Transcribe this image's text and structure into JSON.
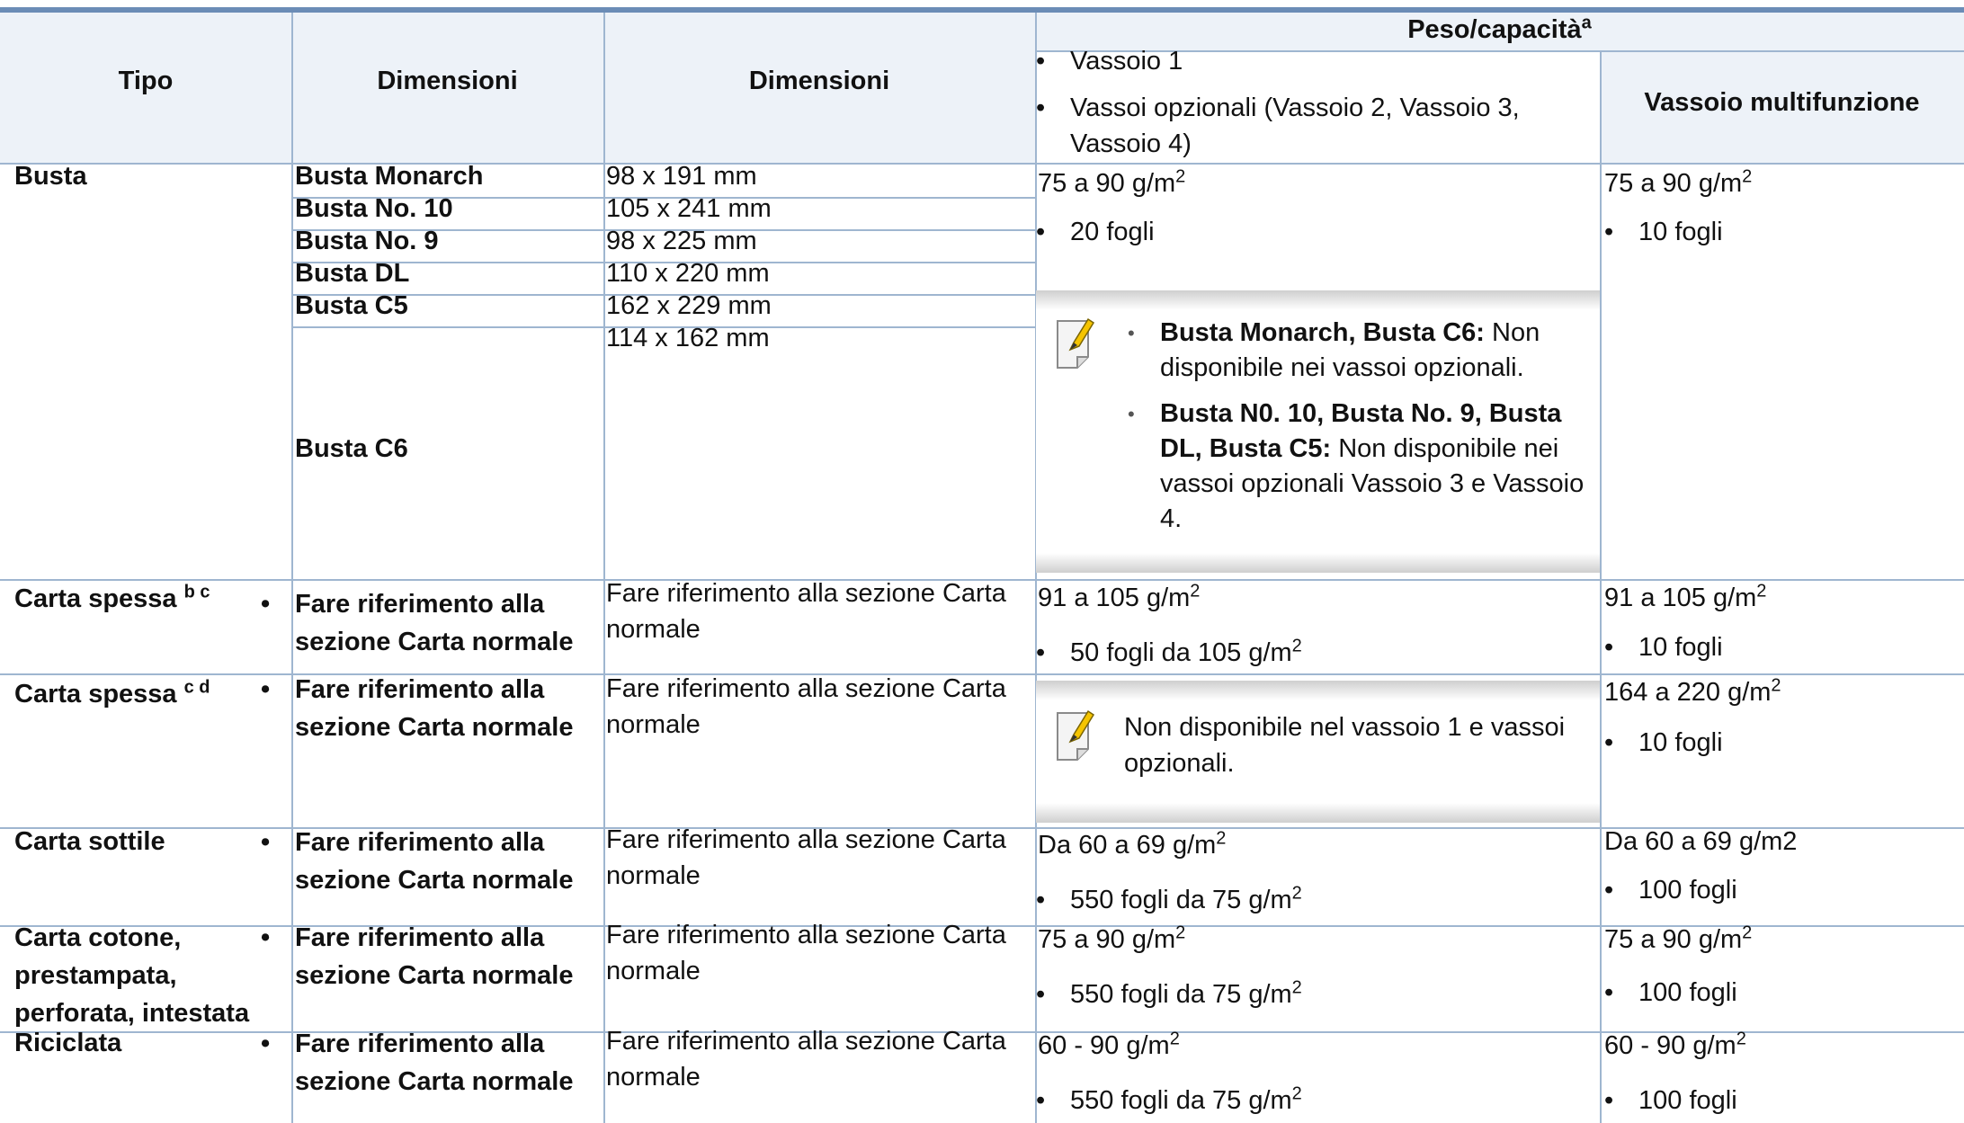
{
  "header": {
    "col1": "Tipo",
    "col2": "Dimensioni",
    "col3": "Dimensioni",
    "peso": "Peso/capacità",
    "peso_sup": "a",
    "tray_items": [
      "Vassoio 1",
      "Vassoi opzionali (Vassoio 2, Vassoio 3, Vassoio 4)"
    ],
    "mp_tray": "Vassoio multifunzione"
  },
  "rows": {
    "busta": {
      "type": "Busta",
      "sizes": [
        {
          "name": "Busta Monarch",
          "dim": "98 x 191 mm"
        },
        {
          "name": "Busta No. 10",
          "dim": "105 x 241 mm"
        },
        {
          "name": "Busta No. 9",
          "dim": "98 x 225 mm"
        },
        {
          "name": "Busta DL",
          "dim": "110 x 220 mm"
        },
        {
          "name": "Busta C5",
          "dim": "162 x 229 mm"
        },
        {
          "name": "Busta C6",
          "dim": "114 x 162 mm"
        }
      ],
      "tray_weight": "75 a 90 g/m",
      "tray_cap": "20 fogli",
      "note1_bold": "Busta Monarch, Busta C6:",
      "note1_text": " Non disponibile nei vassoi opzionali.",
      "note2_bold": "Busta N0. 10, Busta No. 9, Busta DL, Busta C5:",
      "note2_text": " Non disponibile nei vassoi opzionali Vassoio 3 e Vassoio 4.",
      "mp_weight": "75 a 90 g/m",
      "mp_cap": "10 fogli"
    },
    "spessa1": {
      "type": "Carta spessa",
      "sup": "b c",
      "size": "Fare riferimento alla sezione Carta normale",
      "dim": "Fare riferimento alla sezione Carta normale",
      "tray_weight": "91 a 105 g/m",
      "tray_cap": "50 fogli da 105 g/m",
      "mp_weight": "91 a 105 g/m",
      "mp_cap": "10 fogli"
    },
    "spessa2": {
      "type": "Carta spessa",
      "sup": "c d",
      "size": "Fare riferimento alla sezione Carta normale",
      "dim": "Fare riferimento alla sezione Carta normale",
      "note": "Non disponibile nel vassoio 1 e vassoi opzionali.",
      "mp_weight": "164 a 220 g/m",
      "mp_cap": "10 fogli"
    },
    "sottile": {
      "type": "Carta sottile",
      "size": "Fare riferimento alla sezione Carta normale",
      "dim": "Fare riferimento alla sezione Carta normale",
      "tray_weight": "Da 60 a 69 g/m",
      "tray_cap": "550 fogli da 75 g/m",
      "mp_weight": "Da 60 a 69 g/m2",
      "mp_cap": "100 fogli"
    },
    "cotone": {
      "type": "Carta cotone, prestampata, perforata, intestata",
      "size": "Fare riferimento alla sezione Carta normale",
      "dim": "Fare riferimento alla sezione Carta normale",
      "tray_weight": "75 a 90 g/m",
      "tray_cap": "550 fogli da 75 g/m",
      "mp_weight": "75 a 90 g/m",
      "mp_cap": "100 fogli"
    },
    "riciclata": {
      "type": "Riciclata",
      "size": "Fare riferimento alla sezione Carta normale",
      "dim": "Fare riferimento alla sezione Carta normale",
      "tray_weight": "60 - 90 g/m",
      "tray_cap": "550 fogli da 75 g/m",
      "mp_weight": "60 - 90 g/m",
      "mp_cap": "100 fogli"
    }
  },
  "squared": "2",
  "colors": {
    "accent": "#6b8cb6",
    "rule": "#9fb6d0",
    "header_bg": "#edf2f8"
  },
  "icons": {
    "note": "note-pencil-icon"
  }
}
